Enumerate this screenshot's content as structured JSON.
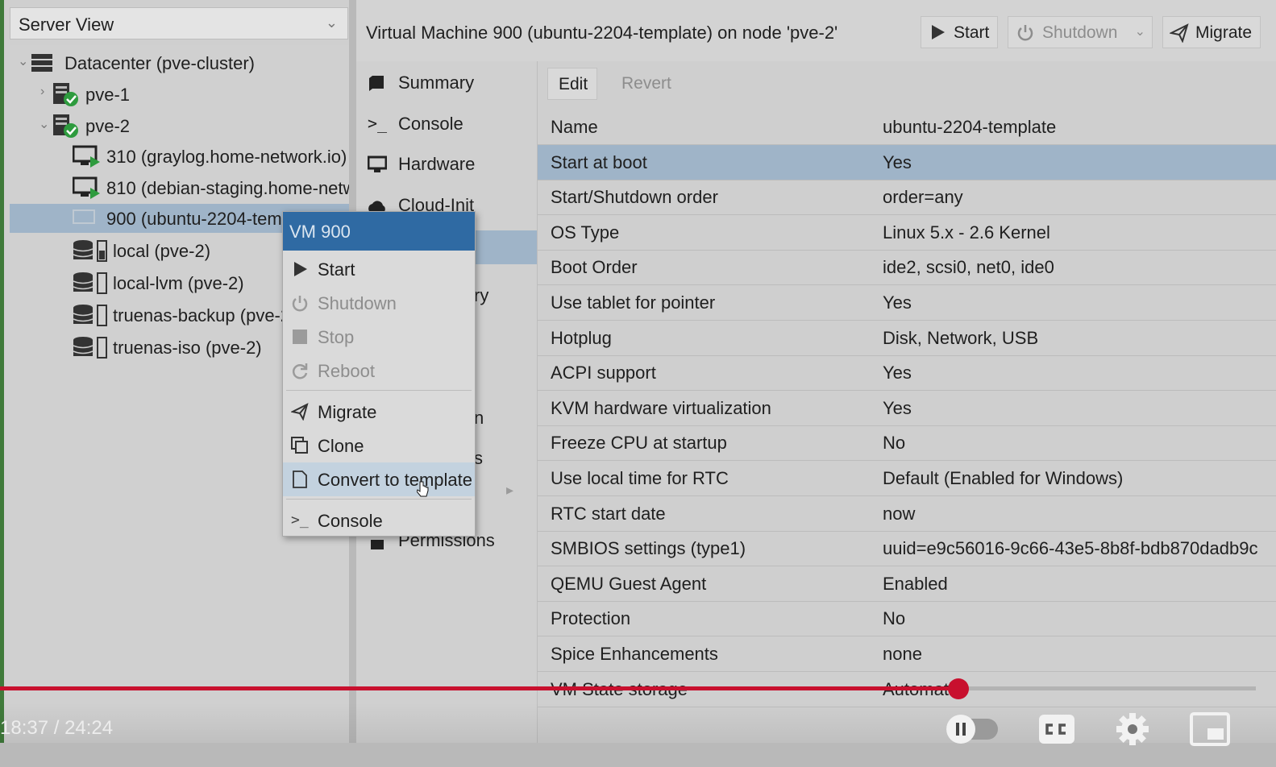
{
  "left_panel": {
    "view_select": "Server View",
    "tree": [
      {
        "label": "Datacenter (pve-cluster)",
        "icon": "datacenter-icon"
      },
      {
        "label": "pve-1",
        "icon": "node-online-icon"
      },
      {
        "label": "pve-2",
        "icon": "node-online-icon"
      },
      {
        "label": "310 (graylog.home-network.io)",
        "icon": "vm-running-icon"
      },
      {
        "label": "810 (debian-staging.home-netw",
        "icon": "vm-running-icon"
      },
      {
        "label": "900 (ubuntu-2204-temp",
        "icon": "vm-stopped-icon"
      },
      {
        "label": "local (pve-2)",
        "icon": "storage-icon"
      },
      {
        "label": "local-lvm (pve-2)",
        "icon": "storage-icon"
      },
      {
        "label": "truenas-backup (pve-2",
        "icon": "storage-icon"
      },
      {
        "label": "truenas-iso (pve-2)",
        "icon": "storage-icon"
      }
    ]
  },
  "header": {
    "title": "Virtual Machine 900 (ubuntu-2204-template) on node 'pve-2'",
    "start_label": "Start",
    "shutdown_label": "Shutdown",
    "migrate_label": "Migrate"
  },
  "nav": [
    {
      "label": "Summary",
      "icon": "summary-icon"
    },
    {
      "label": "Console",
      "icon": "console-icon"
    },
    {
      "label": "Hardware",
      "icon": "hardware-icon"
    },
    {
      "label": "Cloud-Init",
      "icon": "cloud-icon"
    },
    {
      "label": "ry",
      "icon": ""
    },
    {
      "label": "n",
      "icon": ""
    },
    {
      "label": "s",
      "icon": ""
    },
    {
      "label": "Permissions",
      "icon": "permissions-icon"
    }
  ],
  "options_toolbar": {
    "edit_label": "Edit",
    "revert_label": "Revert"
  },
  "options": [
    {
      "key": "Name",
      "value": "ubuntu-2204-template"
    },
    {
      "key": "Start at boot",
      "value": "Yes"
    },
    {
      "key": "Start/Shutdown order",
      "value": "order=any"
    },
    {
      "key": "OS Type",
      "value": "Linux 5.x - 2.6 Kernel"
    },
    {
      "key": "Boot Order",
      "value": "ide2, scsi0, net0, ide0"
    },
    {
      "key": "Use tablet for pointer",
      "value": "Yes"
    },
    {
      "key": "Hotplug",
      "value": "Disk, Network, USB"
    },
    {
      "key": "ACPI support",
      "value": "Yes"
    },
    {
      "key": "KVM hardware virtualization",
      "value": "Yes"
    },
    {
      "key": "Freeze CPU at startup",
      "value": "No"
    },
    {
      "key": "Use local time for RTC",
      "value": "Default (Enabled for Windows)"
    },
    {
      "key": "RTC start date",
      "value": "now"
    },
    {
      "key": "SMBIOS settings (type1)",
      "value": "uuid=e9c56016-9c66-43e5-8b8f-bdb870dadb9c"
    },
    {
      "key": "QEMU Guest Agent",
      "value": "Enabled"
    },
    {
      "key": "Protection",
      "value": "No"
    },
    {
      "key": "Spice Enhancements",
      "value": "none"
    },
    {
      "key": "VM State storage",
      "value": "Automatic"
    }
  ],
  "context_menu": {
    "title": "VM 900",
    "items": [
      {
        "label": "Start",
        "icon": "play-icon",
        "disabled": false
      },
      {
        "label": "Shutdown",
        "icon": "power-icon",
        "disabled": true
      },
      {
        "label": "Stop",
        "icon": "stop-icon",
        "disabled": true
      },
      {
        "label": "Reboot",
        "icon": "reboot-icon",
        "disabled": true
      },
      {
        "label": "Migrate",
        "icon": "migrate-icon",
        "disabled": false
      },
      {
        "label": "Clone",
        "icon": "clone-icon",
        "disabled": false
      },
      {
        "label": "Convert to template",
        "icon": "template-icon",
        "disabled": false
      },
      {
        "label": "Console",
        "icon": "console-icon",
        "disabled": false
      }
    ]
  },
  "video": {
    "timecode": "18:37 / 24:24",
    "progress": 0.763,
    "accent": "#c8102e"
  },
  "colors": {
    "selection": "#9fb4c8",
    "menu_title": "#2f6aa3"
  }
}
